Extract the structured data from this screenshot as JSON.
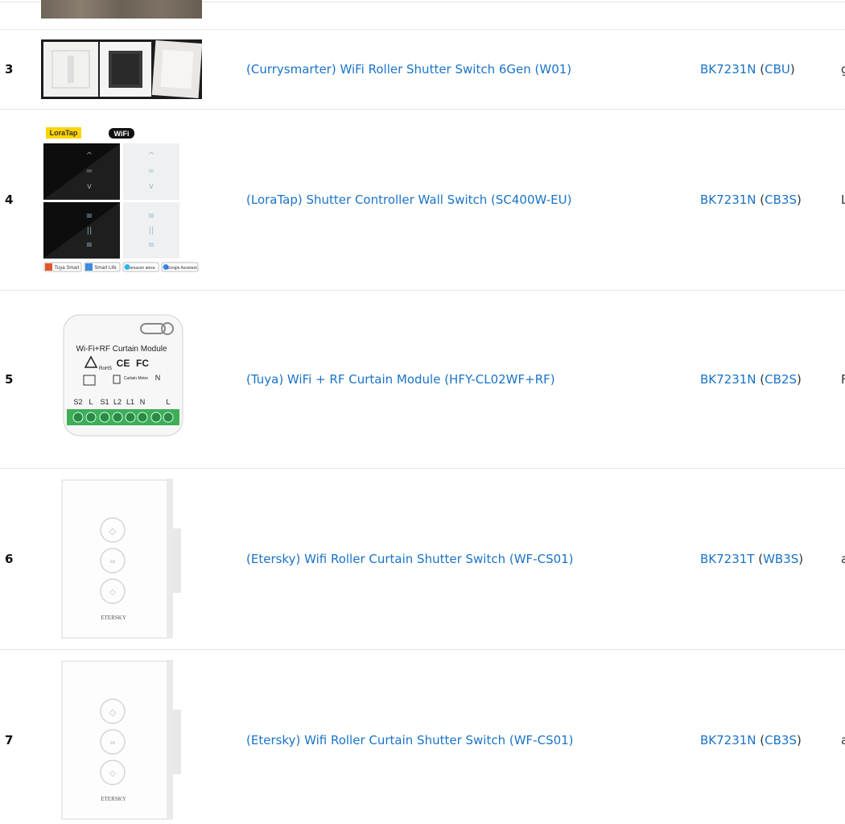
{
  "rows": [
    {
      "num": "",
      "name": "",
      "chip": "",
      "module": "",
      "extra": ""
    },
    {
      "num": "3",
      "name": "(Currysmarter) WiFi Roller Shutter Switch 6Gen (W01)",
      "chip": "BK7231N",
      "module": "CBU",
      "extra": "g"
    },
    {
      "num": "4",
      "name": "(LoraTap) Shutter Controller Wall Switch (SC400W-EU)",
      "chip": "BK7231N",
      "module": "CB3S",
      "extra": "L"
    },
    {
      "num": "5",
      "name": "(Tuya) WiFi + RF Curtain Module (HFY-CL02WF+RF)",
      "chip": "BK7231N",
      "module": "CB2S",
      "extra": "F"
    },
    {
      "num": "6",
      "name": "(Etersky) Wifi Roller Curtain Shutter Switch (WF-CS01)",
      "chip": "BK7231T",
      "module": "WB3S",
      "extra": "a"
    },
    {
      "num": "7",
      "name": "(Etersky) Wifi Roller Curtain Shutter Switch (WF-CS01)",
      "chip": "BK7231N",
      "module": "CB3S",
      "extra": "a"
    }
  ],
  "images": {
    "loratap": {
      "brand": "LoraTap",
      "wifi": "WiFi",
      "badges": [
        "Tuya Smart",
        "Smart Life",
        "amazon alexa",
        "Google Assistant"
      ]
    },
    "tuya_module": {
      "title": "Wi-Fi+RF Curtain Module",
      "rohs": "RoHS",
      "ce": "CE",
      "fc": "FC",
      "motor": "Curtain Motor",
      "terminals": [
        "S2",
        "L",
        "S1",
        "L2",
        "L1",
        "N",
        "N",
        "L"
      ]
    },
    "etersky": {
      "brand": "ETERSKY"
    }
  }
}
